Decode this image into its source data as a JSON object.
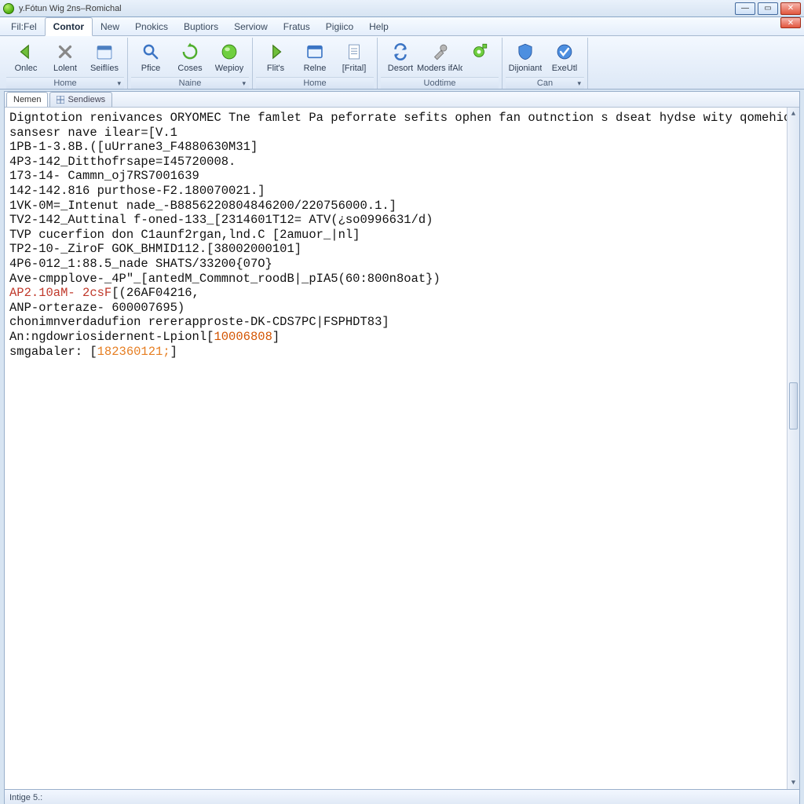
{
  "window": {
    "title": "y.Fótun Wig 2ns–Romichal"
  },
  "menu": {
    "items": [
      "Fil:Fel",
      "Contor",
      "New",
      "Pnokics",
      "Buptiors",
      "Serviow",
      "Fratus",
      "Pigiico",
      "Help"
    ],
    "active_index": 1
  },
  "ribbon": {
    "groups": [
      {
        "label": "Home",
        "dd": true,
        "buttons": [
          {
            "label": "Onlec",
            "icon": "arrow-left-green"
          },
          {
            "label": "Lolent",
            "icon": "x-gray"
          },
          {
            "label": "Seiflíes",
            "icon": "calendar-blue"
          }
        ]
      },
      {
        "label": "Naine",
        "dd": true,
        "buttons": [
          {
            "label": "Pfice",
            "icon": "magnifier-blue"
          },
          {
            "label": "Coses",
            "icon": "refresh-green"
          },
          {
            "label": "Wepioy",
            "icon": "sphere-green"
          }
        ]
      },
      {
        "label": "Home",
        "dd": false,
        "buttons": [
          {
            "label": "Flit's",
            "icon": "arrow-right-green"
          },
          {
            "label": "Relne",
            "icon": "window-blue"
          },
          {
            "label": "[Frital]",
            "icon": "page-blue"
          }
        ]
      },
      {
        "label": "Uodtime",
        "dd": false,
        "buttons": [
          {
            "label": "Desort",
            "icon": "sync-blue"
          },
          {
            "label": "Moders ifAlonsteo",
            "icon": "tools-gray"
          },
          {
            "label": "",
            "icon": "gear-green"
          }
        ]
      },
      {
        "label": "Can",
        "dd": true,
        "buttons": [
          {
            "label": "Dijoniant",
            "icon": "shield-blue"
          },
          {
            "label": "ExeUtl",
            "icon": "check-blue"
          }
        ]
      }
    ]
  },
  "doc_tabs": [
    {
      "label": "Nemen",
      "icon": "none",
      "active": true
    },
    {
      "label": "Sendiews",
      "icon": "table",
      "active": false
    }
  ],
  "lines": [
    {
      "segs": [
        {
          "t": "Digntotion renivances ORYOMEC Tne famlet Pa peforrate sefits ophen fan outnction s dseat hydse wity qomehion"
        }
      ]
    },
    {
      "segs": [
        {
          "t": "sansesr nave ilear=[V.1"
        }
      ]
    },
    {
      "segs": [
        {
          "t": "1PB-1-3.8B.([uUrrane3_F4880630M31]"
        }
      ]
    },
    {
      "segs": [
        {
          "t": "4P3-142_Ditthofrsape=I45720008."
        }
      ]
    },
    {
      "segs": [
        {
          "t": "173-14- Cammn_oj7RS7001639"
        }
      ]
    },
    {
      "segs": [
        {
          "t": "142-142.816 purthose-F2.180070021.]"
        }
      ]
    },
    {
      "segs": [
        {
          "t": "1VK-0M=_Intenut nade_-B8856220804846200/220756000.1.]"
        }
      ]
    },
    {
      "segs": [
        {
          "t": "TV2-142_Auttinal f-oned-133_[2314601T12= ATV(¿so0996631/d)"
        }
      ]
    },
    {
      "segs": [
        {
          "t": "TVP cucerfion don C1aunf2rgan,lnd.C [2amuor_|nl]"
        }
      ]
    },
    {
      "segs": [
        {
          "t": "TP2-10-_ZiroF GOK_BHMID112.[38002000101]"
        }
      ]
    },
    {
      "segs": [
        {
          "t": "4P6-012_1:88.5_nade SHATS/33200{07O}"
        }
      ]
    },
    {
      "segs": [
        {
          "t": "Ave-cmpplove-_4P\"_[antedM_Commnot_roodB|_pIA5(60:800n8oat})"
        }
      ]
    },
    {
      "segs": [
        {
          "t": "AP2.10aM- 2csF",
          "c": "hl-red"
        },
        {
          "t": "[(26AF04216,"
        }
      ]
    },
    {
      "segs": [
        {
          "t": "ANP-orteraze- 600007695)"
        }
      ]
    },
    {
      "segs": [
        {
          "t": "chonimnverdadufion rererapproste-DK-CDS7PC|FSPHDT83]"
        }
      ]
    },
    {
      "segs": [
        {
          "t": "An:ngdowriosidernent-Lpionl["
        },
        {
          "t": "10006808",
          "c": "hl-orange"
        },
        {
          "t": "]"
        }
      ]
    },
    {
      "segs": [
        {
          "t": "smgabaler: ["
        },
        {
          "t": "182360121;",
          "c": "hl-orange2"
        },
        {
          "t": "]"
        }
      ]
    }
  ],
  "status": {
    "text": "Intige 5.:"
  }
}
